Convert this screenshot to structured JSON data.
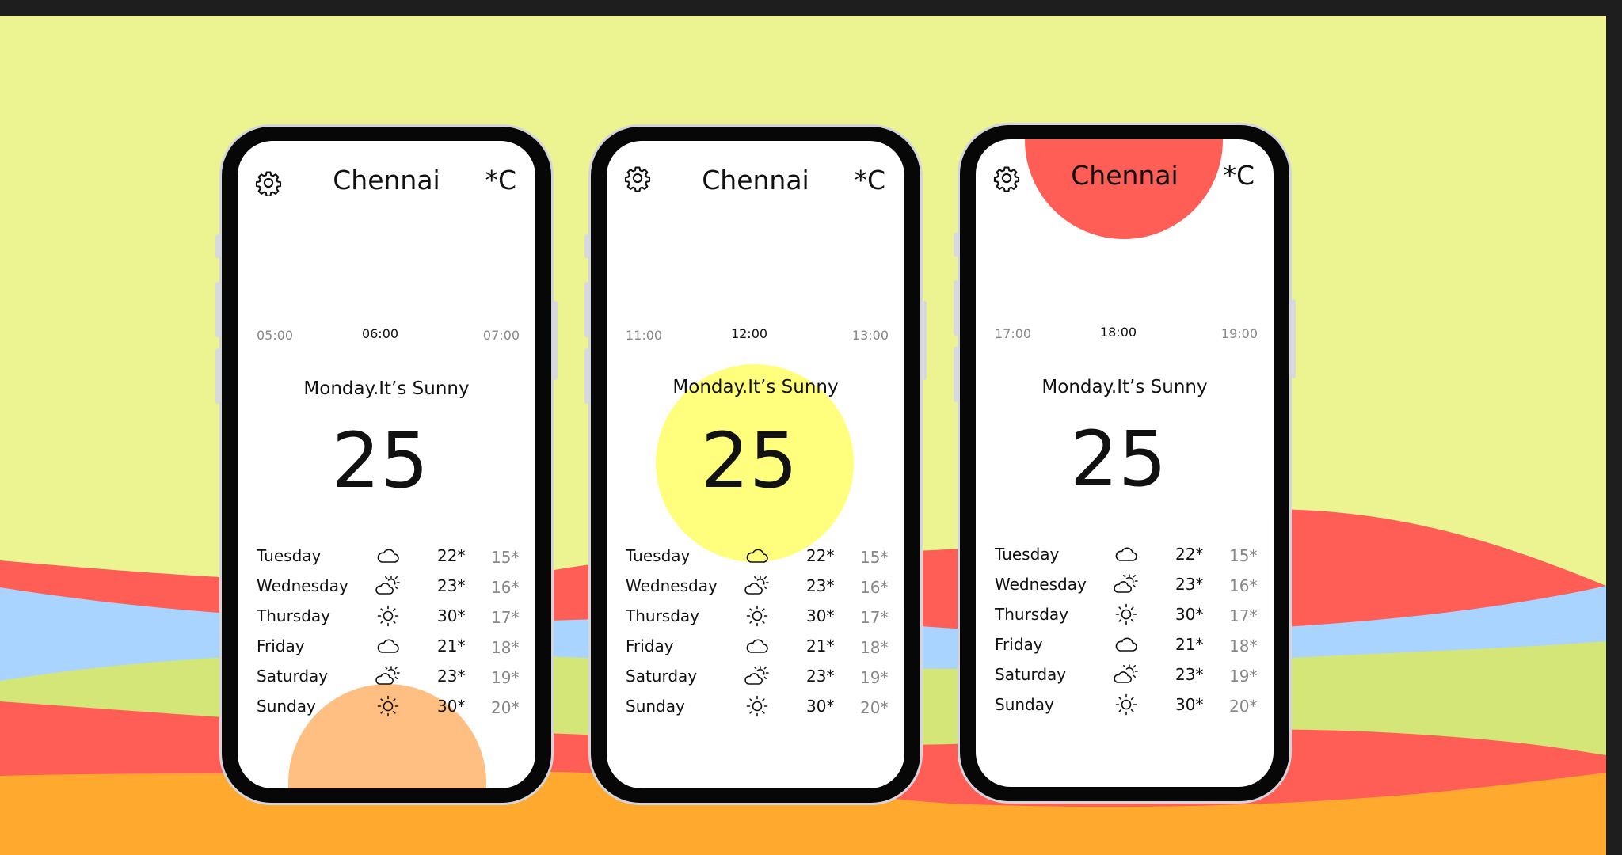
{
  "colors": {
    "frame": "#1e1e1e",
    "background": "#ecf391",
    "wave_red": "#ff5e57",
    "wave_blue": "#a8d4ff",
    "wave_green": "#d3e677",
    "wave_orange": "#ffa92e",
    "sun_morning": "#ffbe82",
    "sun_noon": "#ffff7d",
    "sun_evening": "#ff5e57"
  },
  "phones": [
    {
      "id": "morning",
      "city": "Chennai",
      "unit": "*C",
      "settings_icon": "gear-icon",
      "hours": {
        "prev": "05:00",
        "current": "06:00",
        "next": "07:00"
      },
      "summary": "Monday.It’s Sunny",
      "temperature": "25",
      "sun_color": "#ffbe82",
      "forecast": [
        {
          "day": "Tuesday",
          "icon": "cloud-icon",
          "high": "22*",
          "low": "15*"
        },
        {
          "day": "Wednesday",
          "icon": "partly-sunny-icon",
          "high": "23*",
          "low": "16*"
        },
        {
          "day": "Thursday",
          "icon": "sun-icon",
          "high": "30*",
          "low": "17*"
        },
        {
          "day": "Friday",
          "icon": "cloud-icon",
          "high": "21*",
          "low": "18*"
        },
        {
          "day": "Saturday",
          "icon": "partly-sunny-icon",
          "high": "23*",
          "low": "19*"
        },
        {
          "day": "Sunday",
          "icon": "sun-icon",
          "high": "30*",
          "low": "20*"
        }
      ]
    },
    {
      "id": "noon",
      "city": "Chennai",
      "unit": "*C",
      "settings_icon": "gear-icon",
      "hours": {
        "prev": "11:00",
        "current": "12:00",
        "next": "13:00"
      },
      "summary": "Monday.It’s Sunny",
      "temperature": "25",
      "sun_color": "#ffff7d",
      "forecast": [
        {
          "day": "Tuesday",
          "icon": "cloud-icon",
          "high": "22*",
          "low": "15*"
        },
        {
          "day": "Wednesday",
          "icon": "partly-sunny-icon",
          "high": "23*",
          "low": "16*"
        },
        {
          "day": "Thursday",
          "icon": "sun-icon",
          "high": "30*",
          "low": "17*"
        },
        {
          "day": "Friday",
          "icon": "cloud-icon",
          "high": "21*",
          "low": "18*"
        },
        {
          "day": "Saturday",
          "icon": "partly-sunny-icon",
          "high": "23*",
          "low": "19*"
        },
        {
          "day": "Sunday",
          "icon": "sun-icon",
          "high": "30*",
          "low": "20*"
        }
      ]
    },
    {
      "id": "evening",
      "city": "Chennai",
      "unit": "*C",
      "settings_icon": "gear-icon",
      "hours": {
        "prev": "17:00",
        "current": "18:00",
        "next": "19:00"
      },
      "summary": "Monday.It’s Sunny",
      "temperature": "25",
      "sun_color": "#ff5e57",
      "forecast": [
        {
          "day": "Tuesday",
          "icon": "cloud-icon",
          "high": "22*",
          "low": "15*"
        },
        {
          "day": "Wednesday",
          "icon": "partly-sunny-icon",
          "high": "23*",
          "low": "16*"
        },
        {
          "day": "Thursday",
          "icon": "sun-icon",
          "high": "30*",
          "low": "17*"
        },
        {
          "day": "Friday",
          "icon": "cloud-icon",
          "high": "21*",
          "low": "18*"
        },
        {
          "day": "Saturday",
          "icon": "partly-sunny-icon",
          "high": "23*",
          "low": "19*"
        },
        {
          "day": "Sunday",
          "icon": "sun-icon",
          "high": "30*",
          "low": "20*"
        }
      ]
    }
  ]
}
